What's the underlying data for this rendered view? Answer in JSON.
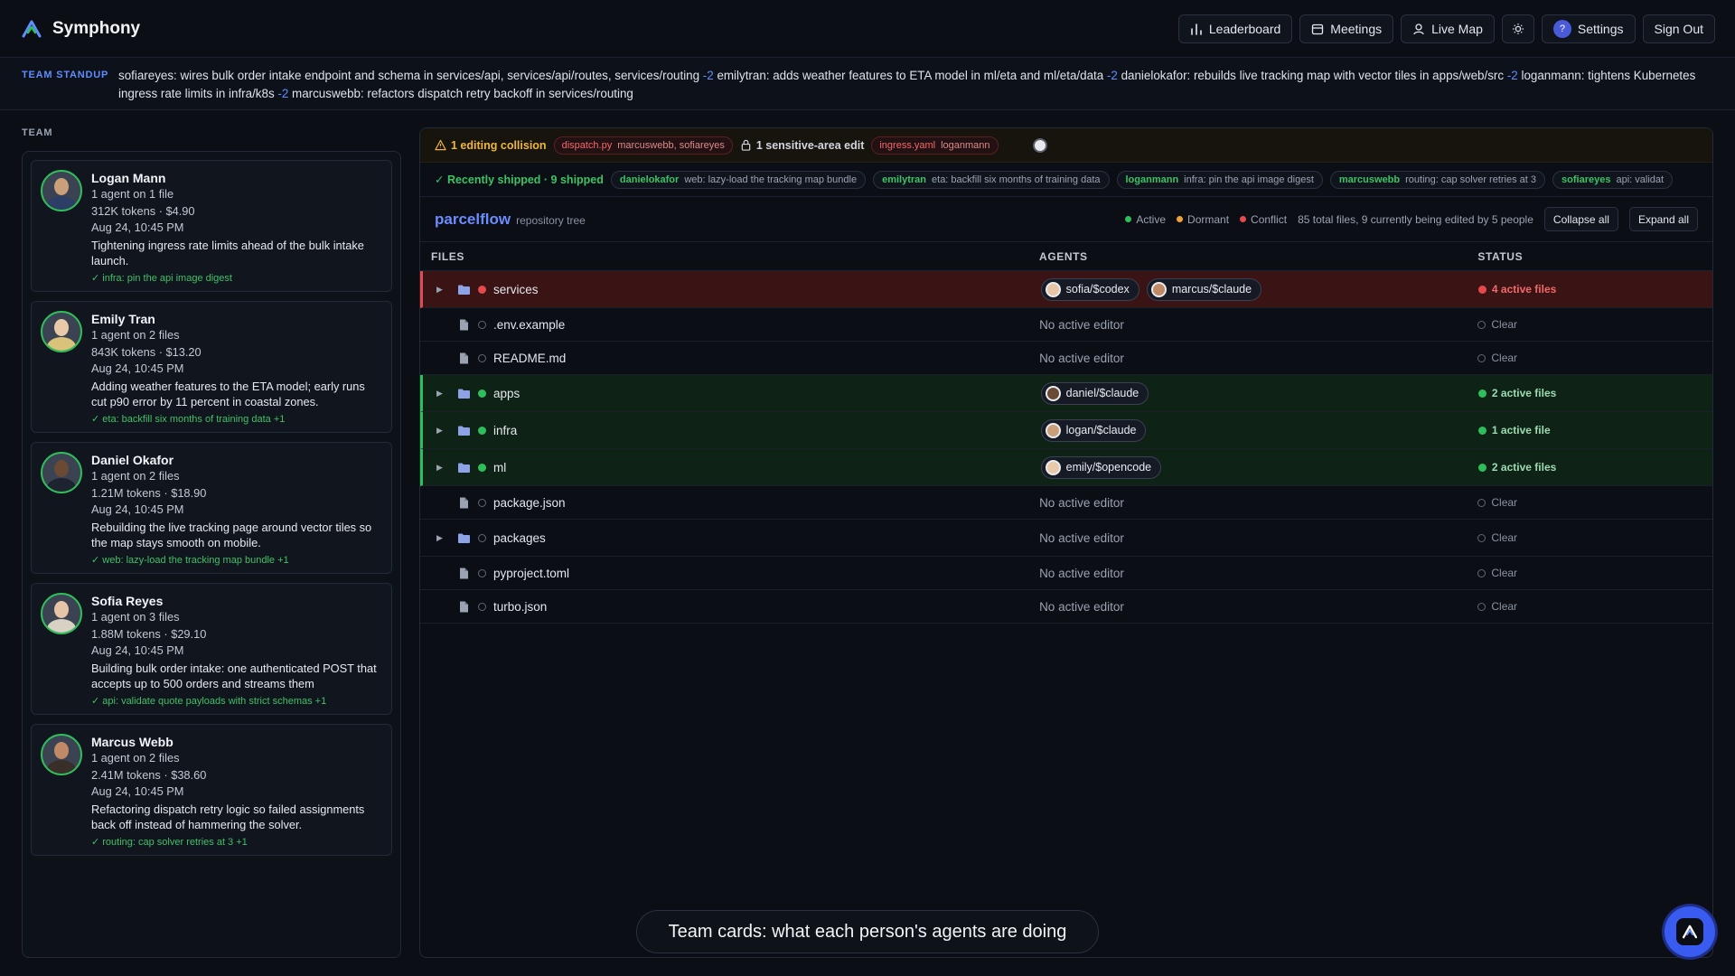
{
  "app": {
    "name": "Symphony"
  },
  "nav": {
    "leaderboard": "Leaderboard",
    "meetings": "Meetings",
    "live_map": "Live Map",
    "settings": "Settings",
    "sign_out": "Sign Out",
    "settings_badge": "?"
  },
  "standup": {
    "label": "TEAM STANDUP",
    "entries": [
      {
        "text": "sofiareyes: wires bulk order intake endpoint and schema in services/api, services/api/routes, services/routing",
        "delta": "-2"
      },
      {
        "text": "emilytran: adds weather features to ETA model in ml/eta and ml/eta/data",
        "delta": "-2"
      },
      {
        "text": "danielokafor: rebuilds live tracking map with vector tiles in apps/web/src",
        "delta": "-2"
      },
      {
        "text": "loganmann: tightens Kubernetes ingress rate limits in infra/k8s",
        "delta": "-2"
      },
      {
        "text": "marcuswebb: refactors dispatch retry backoff in services/routing",
        "delta": ""
      }
    ]
  },
  "team": {
    "label": "TEAM",
    "people": [
      {
        "name": "Logan Mann",
        "agents": "1 agent on 1 file",
        "usage": "312K tokens · $4.90",
        "time": "Aug 24, 10:45 PM",
        "desc": "Tightening ingress rate limits ahead of the bulk intake launch.",
        "shipped": "✓ infra: pin the api image digest",
        "skin": "#c9a07a",
        "shirt": "#2c3e66"
      },
      {
        "name": "Emily Tran",
        "agents": "1 agent on 2 files",
        "usage": "843K tokens · $13.20",
        "time": "Aug 24, 10:45 PM",
        "desc": "Adding weather features to the ETA model; early runs cut p90 error by 11 percent in coastal zones.",
        "shipped": "✓ eta: backfill six months of training data +1",
        "skin": "#e8c9a8",
        "shirt": "#d9c27a"
      },
      {
        "name": "Daniel Okafor",
        "agents": "1 agent on 2 files",
        "usage": "1.21M tokens · $18.90",
        "time": "Aug 24, 10:45 PM",
        "desc": "Rebuilding the live tracking page around vector tiles so the map stays smooth on mobile.",
        "shipped": "✓ web: lazy-load the tracking map bundle +1",
        "skin": "#6a4a34",
        "shirt": "#1d2430"
      },
      {
        "name": "Sofia Reyes",
        "agents": "1 agent on 3 files",
        "usage": "1.88M tokens · $29.10",
        "time": "Aug 24, 10:45 PM",
        "desc": "Building bulk order intake: one authenticated POST that accepts up to 500 orders and streams them",
        "shipped": "✓ api: validate quote payloads with strict schemas +1",
        "skin": "#e6c4a6",
        "shirt": "#d8d2c4"
      },
      {
        "name": "Marcus Webb",
        "agents": "1 agent on 2 files",
        "usage": "2.41M tokens · $38.60",
        "time": "Aug 24, 10:45 PM",
        "desc": "Refactoring dispatch retry logic so failed assignments back off instead of hammering the solver.",
        "shipped": "✓ routing: cap solver retries at 3 +1",
        "skin": "#c08a66",
        "shirt": "#3a2e28"
      }
    ]
  },
  "alerts": {
    "collision": "1 editing collision",
    "collision_file": "dispatch.py",
    "collision_who": "marcuswebb, sofiareyes",
    "sensitive": "1 sensitive-area edit",
    "sensitive_file": "ingress.yaml",
    "sensitive_who": "loganmann"
  },
  "shipped": {
    "label": "✓ Recently shipped · 9 shipped",
    "items": [
      {
        "who": "danielokafor",
        "what": "web: lazy-load the tracking map bundle"
      },
      {
        "who": "emilytran",
        "what": "eta: backfill six months of training data"
      },
      {
        "who": "loganmann",
        "what": "infra: pin the api image digest"
      },
      {
        "who": "marcuswebb",
        "what": "routing: cap solver retries at 3"
      },
      {
        "who": "sofiareyes",
        "what": "api: validat"
      }
    ]
  },
  "repo": {
    "name": "parcelflow",
    "sub": "repository tree",
    "legend_active": "Active",
    "legend_dormant": "Dormant",
    "legend_conflict": "Conflict",
    "summary": "85 total files, 9 currently being edited by 5 people",
    "collapse": "Collapse all",
    "expand": "Expand all",
    "colors": {
      "active": "#2fbf5a",
      "dormant": "#f0a23a",
      "conflict": "#e5484d"
    }
  },
  "table": {
    "headers": {
      "files": "FILES",
      "agents": "AGENTS",
      "status": "STATUS"
    },
    "rows": [
      {
        "name": "services",
        "kind": "folder",
        "state": "conflict",
        "agents": [
          {
            "label": "sofia/$codex",
            "color": "#e6c4a6"
          },
          {
            "label": "marcus/$claude",
            "color": "#c08a66"
          }
        ],
        "status": "4 active files"
      },
      {
        "name": ".env.example",
        "kind": "file",
        "state": "clear",
        "agents": [],
        "status": "Clear"
      },
      {
        "name": "README.md",
        "kind": "file",
        "state": "clear",
        "agents": [],
        "status": "Clear"
      },
      {
        "name": "apps",
        "kind": "folder",
        "state": "active",
        "agents": [
          {
            "label": "daniel/$claude",
            "color": "#6a4a34"
          }
        ],
        "status": "2 active files"
      },
      {
        "name": "infra",
        "kind": "folder",
        "state": "active",
        "agents": [
          {
            "label": "logan/$claude",
            "color": "#c9a07a"
          }
        ],
        "status": "1 active file"
      },
      {
        "name": "ml",
        "kind": "folder",
        "state": "active",
        "agents": [
          {
            "label": "emily/$opencode",
            "color": "#e8c9a8"
          }
        ],
        "status": "2 active files"
      },
      {
        "name": "package.json",
        "kind": "file",
        "state": "clear",
        "agents": [],
        "status": "Clear"
      },
      {
        "name": "packages",
        "kind": "folder",
        "state": "clear",
        "agents": [],
        "status": "Clear"
      },
      {
        "name": "pyproject.toml",
        "kind": "file",
        "state": "clear",
        "agents": [],
        "status": "Clear"
      },
      {
        "name": "turbo.json",
        "kind": "file",
        "state": "clear",
        "agents": [],
        "status": "Clear"
      }
    ],
    "no_editor": "No active editor"
  },
  "caption": "Team cards: what each person's agents are doing"
}
